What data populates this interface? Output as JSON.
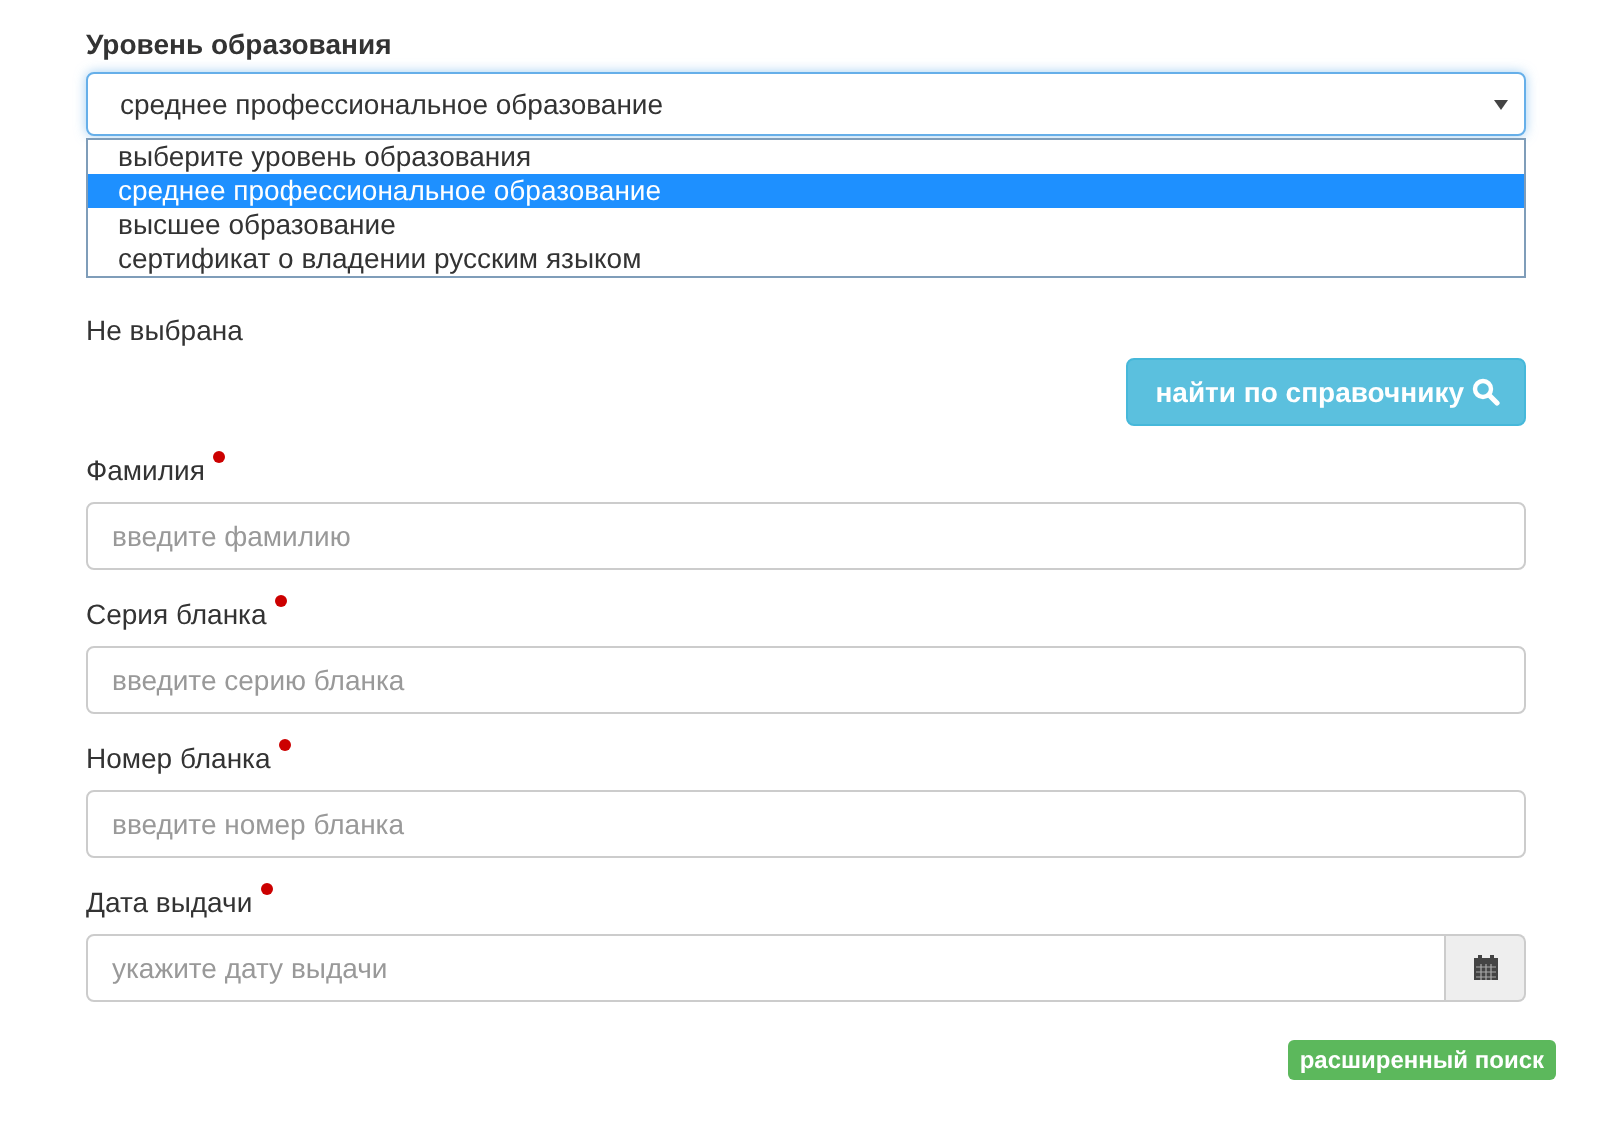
{
  "education": {
    "label": "Уровень образования",
    "value": "среднее профессиональное образование",
    "expanded": true,
    "options": [
      {
        "label": "выберите уровень образования",
        "selected": false
      },
      {
        "label": "среднее профессиональное образование",
        "selected": true
      },
      {
        "label": "высшее образование",
        "selected": false
      },
      {
        "label": "сертификат о владении русским языком",
        "selected": false
      }
    ]
  },
  "organization": {
    "value": "Не выбрана",
    "button": "найти по справочнику"
  },
  "fields": [
    {
      "kind": "text",
      "label": "Фамилия",
      "required": true,
      "placeholder": "введите фамилию"
    },
    {
      "kind": "text",
      "label": "Серия бланка",
      "required": true,
      "placeholder": "введите серию бланка"
    },
    {
      "kind": "text",
      "label": "Номер бланка",
      "required": true,
      "placeholder": "введите номер бланка"
    },
    {
      "kind": "date",
      "label": "Дата выдачи",
      "required": true,
      "placeholder": "укажите дату выдачи"
    }
  ],
  "advanced_search": "расширенный поиск"
}
